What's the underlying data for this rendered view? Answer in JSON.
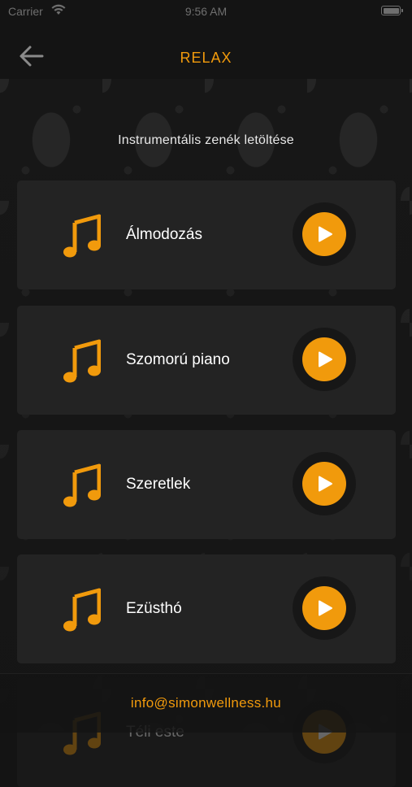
{
  "status_bar": {
    "carrier": "Carrier",
    "time": "9:56 AM"
  },
  "header": {
    "title": "RELAX",
    "back_icon": "arrow-left-icon"
  },
  "subtitle": "Instrumentális zenék letöltése",
  "tracks": [
    {
      "name": "Álmodozás"
    },
    {
      "name": "Szomorú piano"
    },
    {
      "name": "Szeretlek"
    },
    {
      "name": "Ezüsthó"
    },
    {
      "name": "Téli este"
    }
  ],
  "footer": {
    "email": "info@simonwellness.hu"
  },
  "colors": {
    "accent": "#f19a0c",
    "card": "#232323",
    "background": "#141414"
  }
}
